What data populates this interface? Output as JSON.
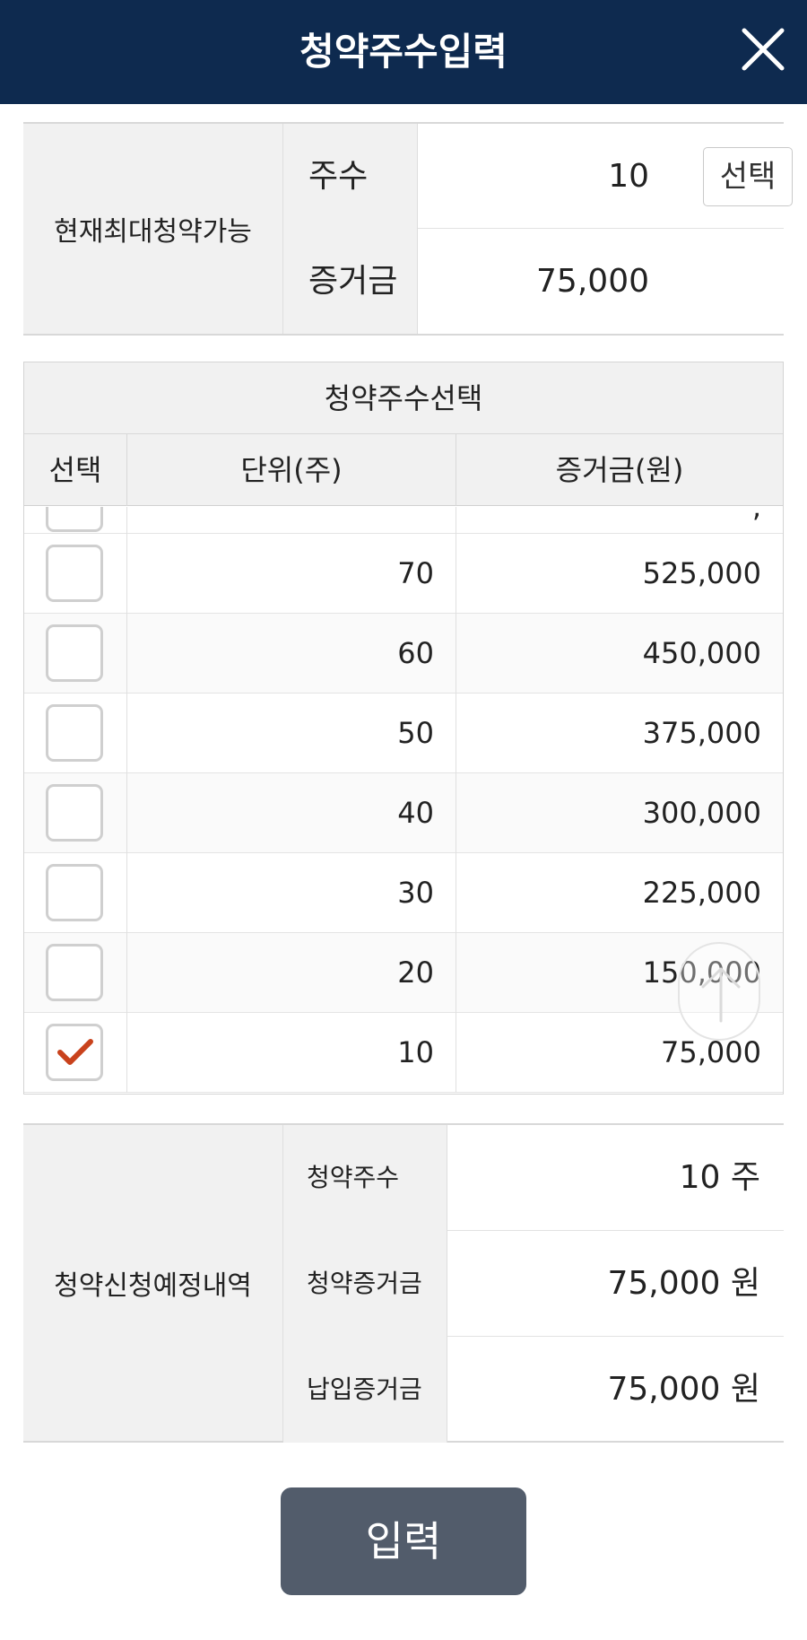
{
  "header": {
    "title": "청약주수입력"
  },
  "max_available": {
    "label": "현재최대청약가능",
    "shares_label": "주수",
    "shares_value": "10",
    "select_button": "선택",
    "deposit_label": "증거금",
    "deposit_value": "75,000"
  },
  "selection": {
    "title": "청약주수선택",
    "columns": [
      "선택",
      "단위(주)",
      "증거금(원)"
    ],
    "partial_row": {
      "unit": "",
      "deposit": ","
    },
    "rows": [
      {
        "unit": "70",
        "deposit": "525,000",
        "checked": false
      },
      {
        "unit": "60",
        "deposit": "450,000",
        "checked": false
      },
      {
        "unit": "50",
        "deposit": "375,000",
        "checked": false
      },
      {
        "unit": "40",
        "deposit": "300,000",
        "checked": false
      },
      {
        "unit": "30",
        "deposit": "225,000",
        "checked": false
      },
      {
        "unit": "20",
        "deposit": "150,000",
        "checked": false
      },
      {
        "unit": "10",
        "deposit": "75,000",
        "checked": true
      }
    ]
  },
  "summary": {
    "label": "청약신청예정내역",
    "shares_label": "청약주수",
    "shares_value": "10 주",
    "deposit_label": "청약증거금",
    "deposit_value": "75,000 원",
    "paid_label": "납입증거금",
    "paid_value": "75,000 원"
  },
  "submit_button": "입력",
  "colors": {
    "header_bg": "#0e2a4f",
    "check": "#c9421c",
    "button_bg": "#525c6b"
  }
}
